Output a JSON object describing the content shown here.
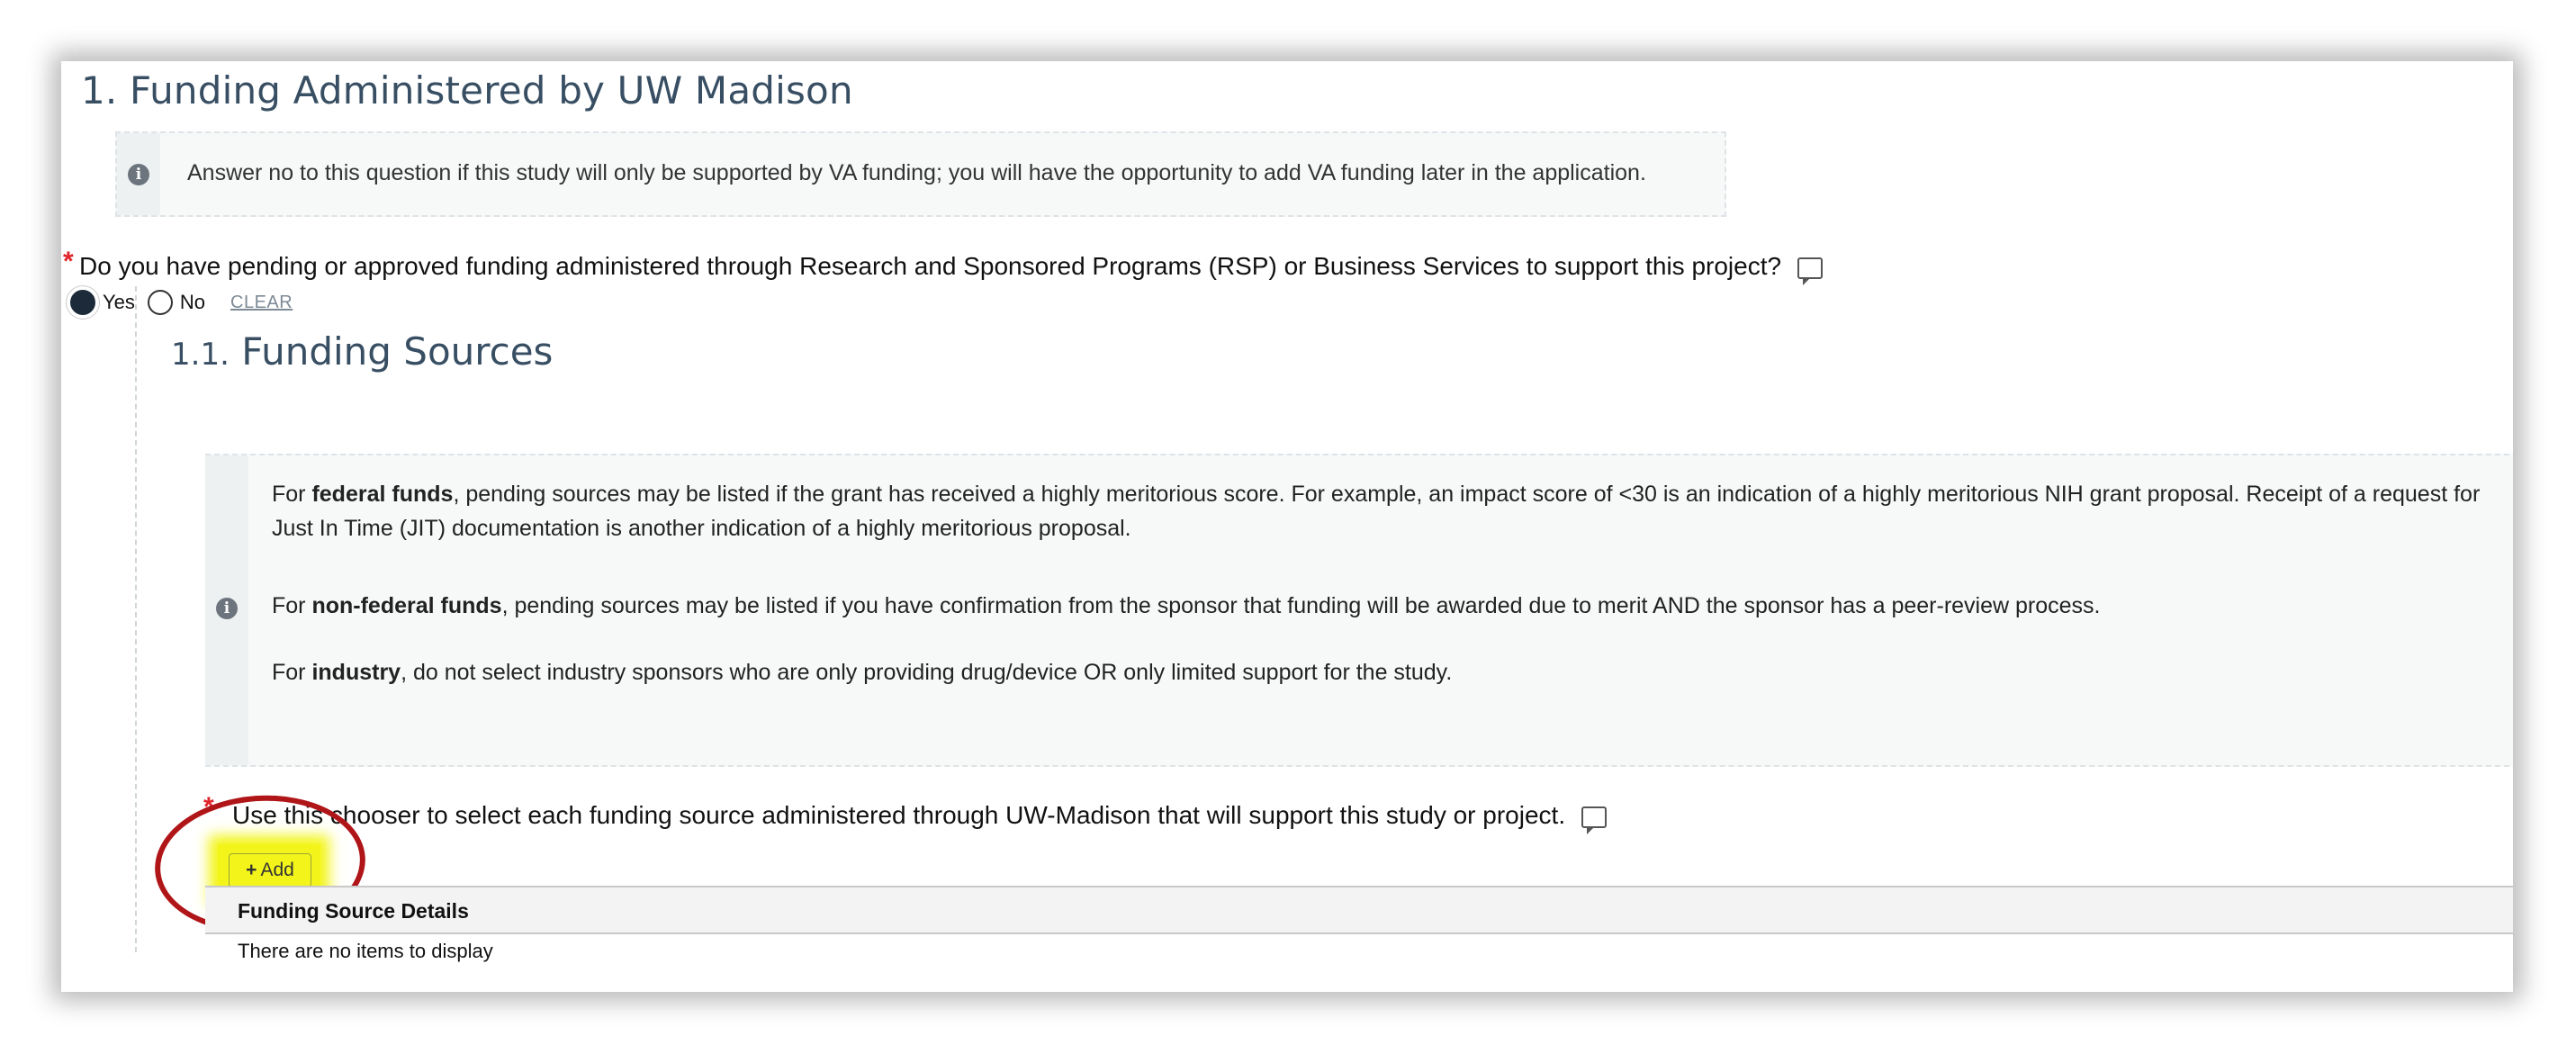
{
  "section1": {
    "title": "1. Funding Administered by UW Madison",
    "info": "Answer no to this question if this study will only be supported by VA funding; you will have the opportunity to add VA funding later in the application.",
    "question": "Do you have pending or approved funding administered through Research and Sponsored Programs (RSP) or Business Services to support this project?",
    "required_marker": "*",
    "options": {
      "yes": "Yes",
      "no": "No",
      "selected": "Yes"
    },
    "clear_label": "CLEAR"
  },
  "section1_1": {
    "number": "1.1.",
    "title": "Funding Sources",
    "info": {
      "p1_bold": "federal funds",
      "p1_pre": "For ",
      "p1_post": ", pending sources may be listed if the grant has received a highly meritorious score. For example, an impact score of <30 is an indication of a highly meritorious NIH grant proposal. Receipt of a request for Just In Time (JIT) documentation is another indication of a highly meritorious proposal.",
      "p2_pre": "For ",
      "p2_bold": "non-federal funds",
      "p2_post": ", pending sources may be listed if you have confirmation from the sponsor that funding will be awarded due to merit AND the sponsor has a peer-review process.",
      "p3_pre": "For ",
      "p3_bold": "industry",
      "p3_post": ", do not select industry sponsors who are only providing drug/device OR only limited support for the study."
    },
    "question": "Use this chooser to select each funding source administered through UW-Madison that will support this study or project.",
    "required_marker": "*",
    "add_plus": "+",
    "add_label": "Add",
    "table": {
      "header": "Funding Source Details",
      "empty": "There are no items to display"
    }
  },
  "colors": {
    "heading": "#384e63",
    "required": "#e0252b",
    "highlight": "#f3f51a",
    "annotation_circle": "#b01518"
  }
}
